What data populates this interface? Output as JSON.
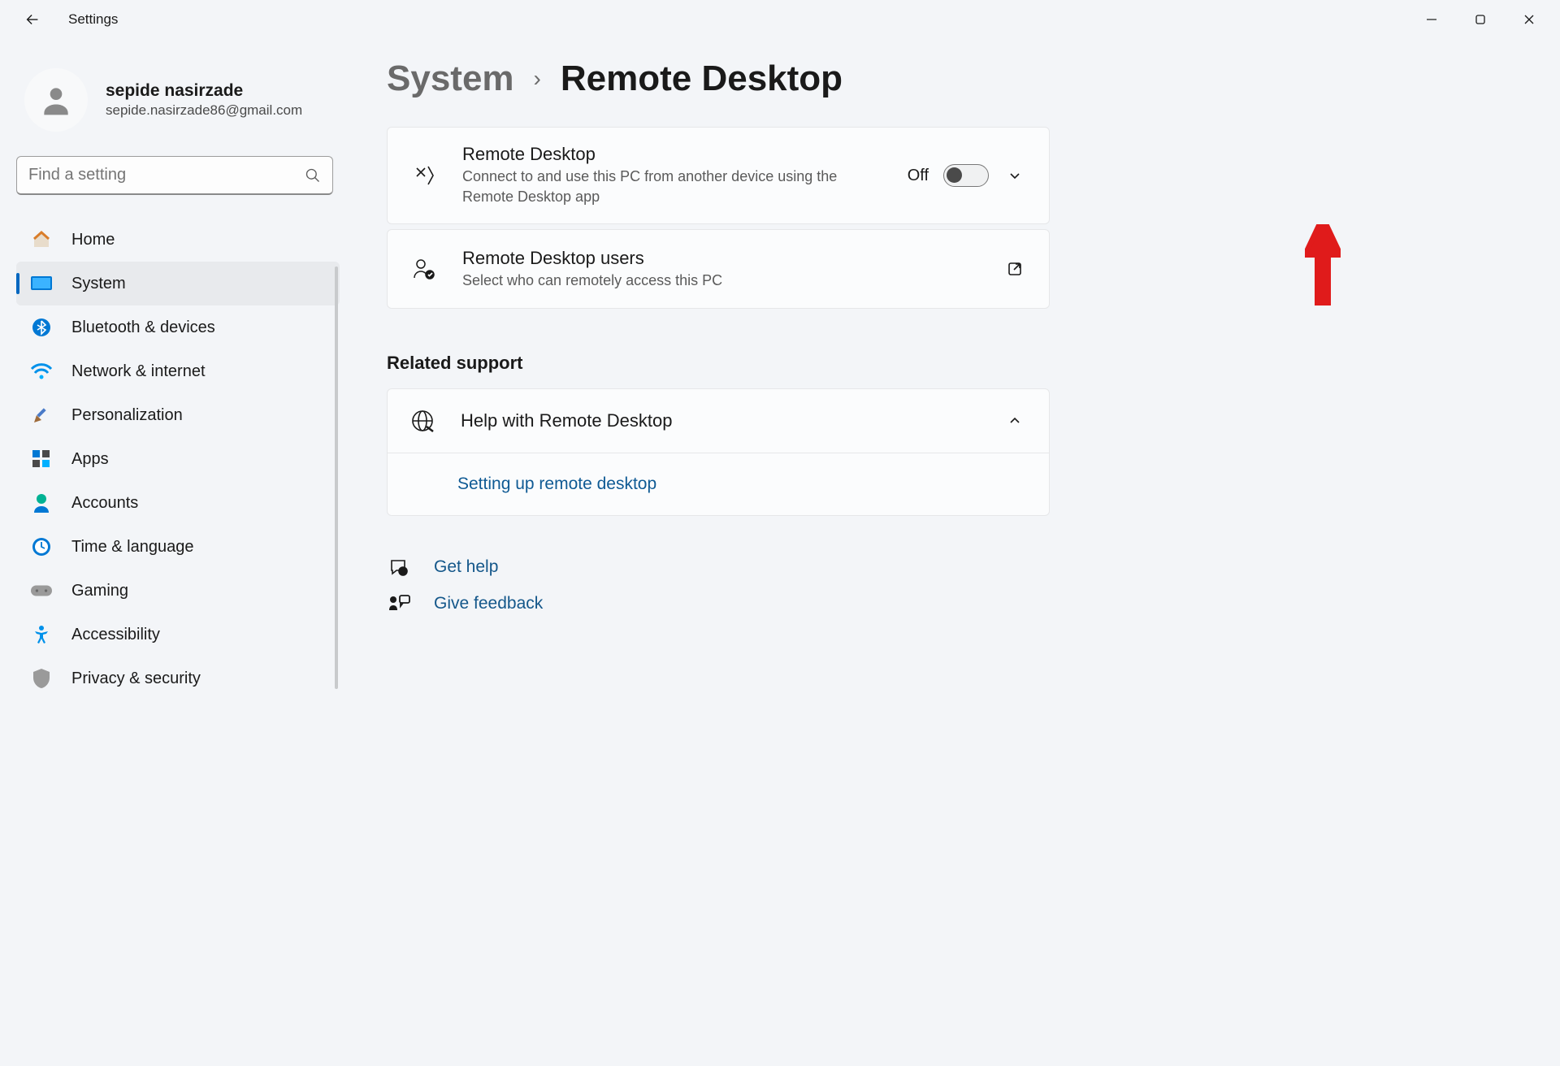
{
  "window": {
    "title": "Settings"
  },
  "user": {
    "name": "sepide nasirzade",
    "email": "sepide.nasirzade86@gmail.com"
  },
  "search": {
    "placeholder": "Find a setting"
  },
  "nav": {
    "items": [
      {
        "label": "Home"
      },
      {
        "label": "System"
      },
      {
        "label": "Bluetooth & devices"
      },
      {
        "label": "Network & internet"
      },
      {
        "label": "Personalization"
      },
      {
        "label": "Apps"
      },
      {
        "label": "Accounts"
      },
      {
        "label": "Time & language"
      },
      {
        "label": "Gaming"
      },
      {
        "label": "Accessibility"
      },
      {
        "label": "Privacy & security"
      }
    ]
  },
  "breadcrumb": {
    "parent": "System",
    "current": "Remote Desktop"
  },
  "cards": {
    "remote": {
      "title": "Remote Desktop",
      "desc": "Connect to and use this PC from another device using the Remote Desktop app",
      "toggle_label": "Off"
    },
    "users": {
      "title": "Remote Desktop users",
      "desc": "Select who can remotely access this PC"
    }
  },
  "support": {
    "section_title": "Related support",
    "help_title": "Help with Remote Desktop",
    "setup_link": "Setting up remote desktop"
  },
  "footer": {
    "help": "Get help",
    "feedback": "Give feedback"
  }
}
